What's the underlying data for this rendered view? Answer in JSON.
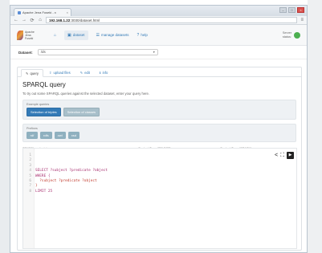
{
  "browser": {
    "tab_title": "Apache Jena Fuseki - x",
    "tab_close": "×",
    "url_host": "192.168.1.22",
    "url_rest": ":3030/dataset.html",
    "win_min": "–",
    "win_max": "□",
    "win_close": "×",
    "back": "←",
    "forward": "→",
    "reload": "⟳",
    "home": "⌂",
    "menu": "≡"
  },
  "header": {
    "logo_text": [
      "Apache",
      "Jena",
      "Fuseki"
    ],
    "nav": [
      {
        "icon": "⌂",
        "label": ""
      },
      {
        "icon": "▣",
        "label": "dataset",
        "active": true
      },
      {
        "icon": "☰",
        "label": "manage datasets",
        "active": false
      },
      {
        "icon": "?",
        "label": "help",
        "active": false
      }
    ],
    "server_status_lines": [
      "Server",
      "status:"
    ],
    "colors": {
      "accent": "#337ab7",
      "status_ok": "#4caf50"
    }
  },
  "dataset": {
    "label": "Dataset:",
    "selected": "/ds",
    "caret": "▾"
  },
  "tabs": [
    {
      "icon": "✎",
      "label": "query",
      "active": true
    },
    {
      "icon": "⇧",
      "label": "upload files",
      "active": false
    },
    {
      "icon": "✎",
      "label": "edit",
      "active": false
    },
    {
      "icon": "ℹ",
      "label": "info",
      "active": false
    }
  ],
  "query": {
    "title": "SPARQL query",
    "description": "To try out some SPARQL queries against the selected dataset, enter your query here.",
    "examples_label": "Example queries",
    "example_buttons": [
      "Selection of triples",
      "Selection of classes"
    ],
    "prefixes_label": "Prefixes",
    "prefix_buttons": [
      "rdf",
      "rdfs",
      "owl",
      "xsd"
    ],
    "endpoint_label": "SPARQL endpoint",
    "endpoint_value": "http://192.168.1.22:3030/ds/query",
    "content_type_select_label": "Content Type (SELECT)",
    "content_type_select_value": "JSON",
    "content_type_graph_label": "Content Type (GRAPH)",
    "content_type_graph_value": "Turtle",
    "caret": "▾"
  },
  "editor": {
    "toolbar": {
      "share": "<",
      "fullscreen": "⛶",
      "run": "▶"
    },
    "lines": [
      {
        "n": "1",
        "text": "",
        "kw": false
      },
      {
        "n": "2",
        "text": "",
        "kw": false
      },
      {
        "n": "3",
        "text": "",
        "kw": false
      },
      {
        "n": "4",
        "text": "SELECT ?subject ?predicate ?object",
        "kw": true
      },
      {
        "n": "5",
        "text": "WHERE {",
        "kw": true
      },
      {
        "n": "6",
        "text": "  ?subject ?predicate ?object",
        "kw": false
      },
      {
        "n": "7",
        "text": "}",
        "kw": false
      },
      {
        "n": "8",
        "text": "LIMIT 25",
        "kw": true
      }
    ]
  }
}
